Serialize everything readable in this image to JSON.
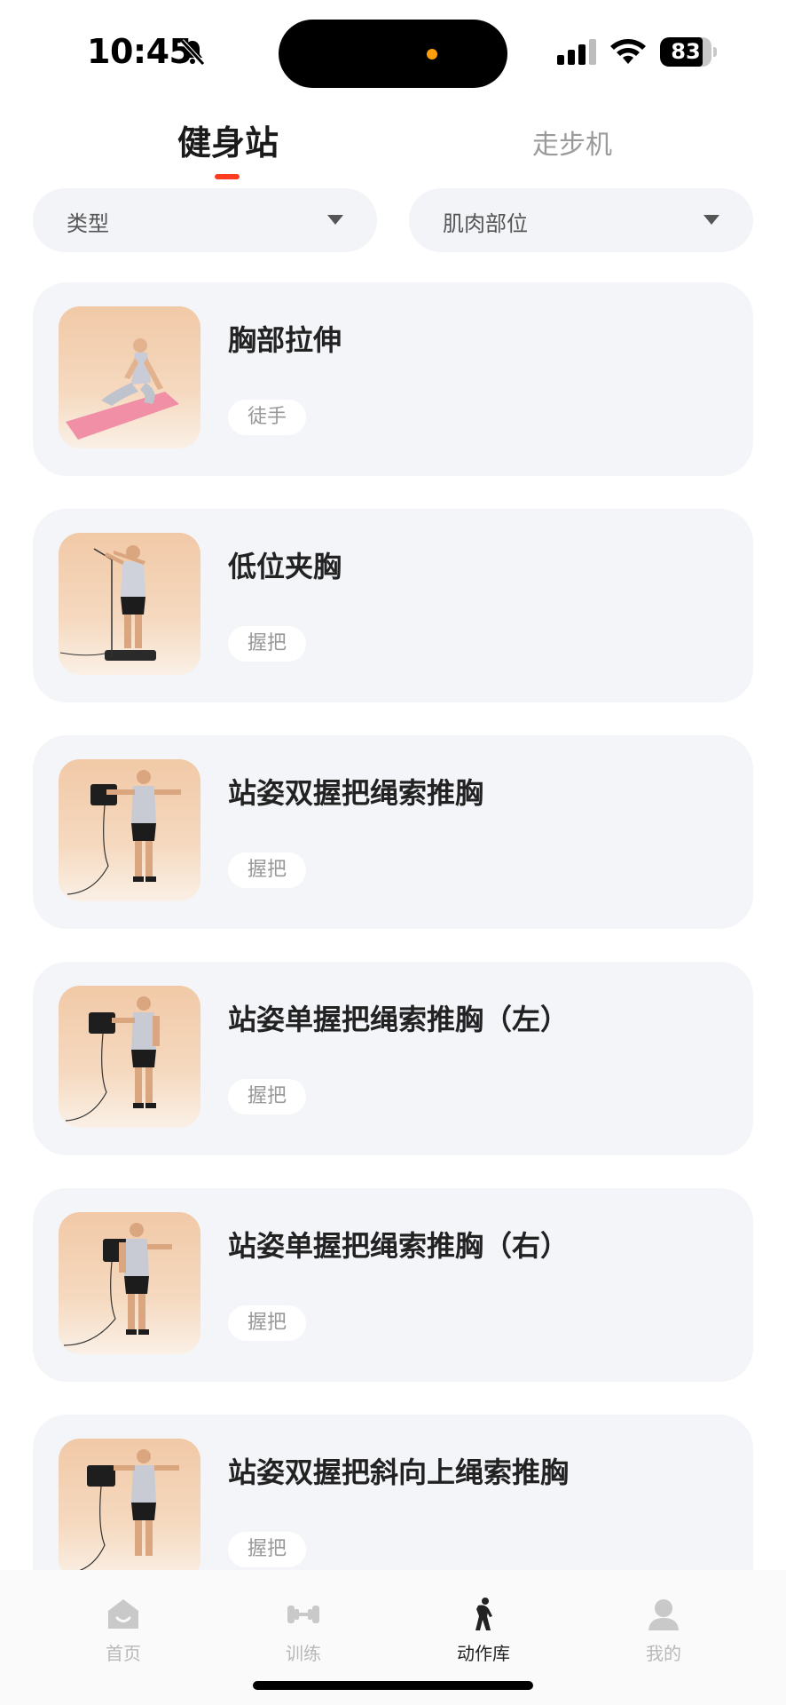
{
  "status_bar": {
    "time": "10:45",
    "battery_text": "83",
    "battery_level": 0.83
  },
  "top_tabs": [
    {
      "label": "健身站",
      "active": true
    },
    {
      "label": "走步机",
      "active": false
    }
  ],
  "filters": [
    {
      "label": "类型"
    },
    {
      "label": "肌肉部位"
    }
  ],
  "exercises": [
    {
      "title": "胸部拉伸",
      "tag": "徒手"
    },
    {
      "title": "低位夹胸",
      "tag": "握把"
    },
    {
      "title": "站姿双握把绳索推胸",
      "tag": "握把"
    },
    {
      "title": "站姿单握把绳索推胸（左）",
      "tag": "握把"
    },
    {
      "title": "站姿单握把绳索推胸（右）",
      "tag": "握把"
    },
    {
      "title": "站姿双握把斜向上绳索推胸",
      "tag": "握把"
    }
  ],
  "bottom_nav": [
    {
      "label": "首页",
      "icon": "home-icon",
      "active": false
    },
    {
      "label": "训练",
      "icon": "dumbbell-icon",
      "active": false
    },
    {
      "label": "动作库",
      "icon": "stretch-figure-icon",
      "active": true
    },
    {
      "label": "我的",
      "icon": "person-icon",
      "active": false
    }
  ],
  "colors": {
    "accent": "#ff3b1f",
    "card_bg": "#f4f5f8",
    "island_dot": "#ff9f0a"
  }
}
